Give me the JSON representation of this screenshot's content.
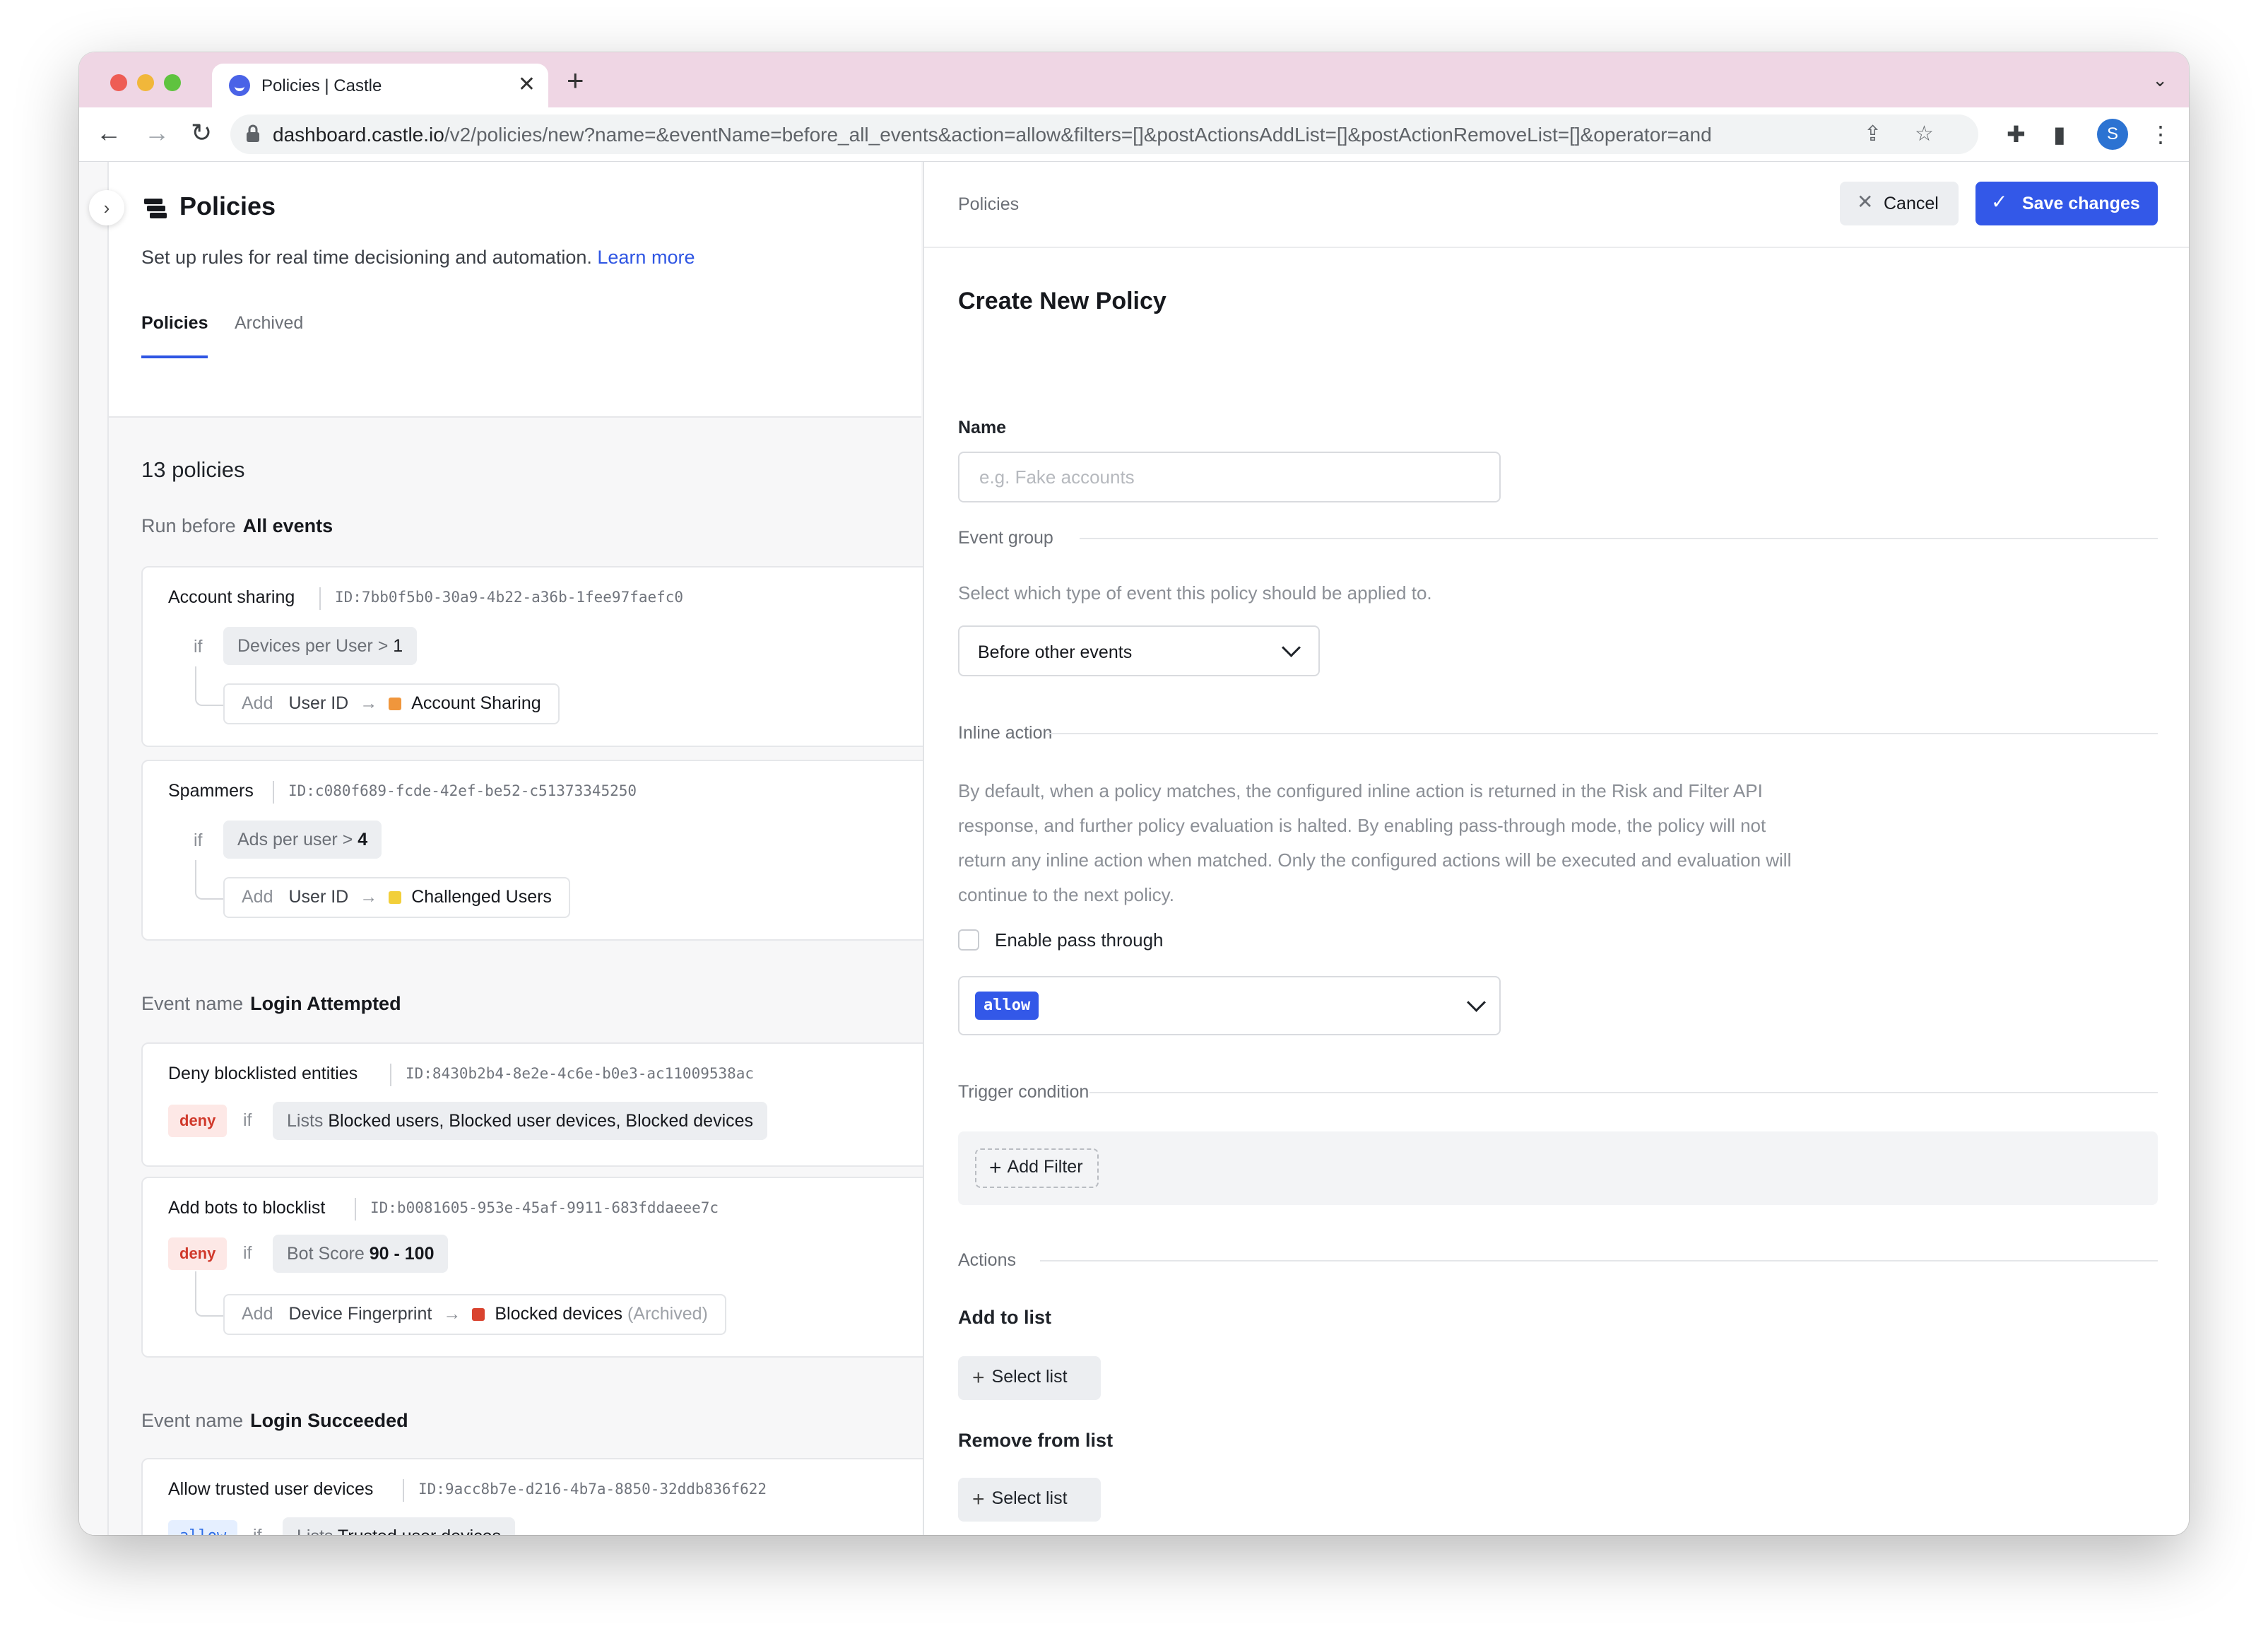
{
  "browser": {
    "tab_title": "Policies | Castle",
    "url_host": "dashboard.castle.io",
    "url_path": "/v2/policies/new?name=&eventName=before_all_events&action=allow&filters=[]&postActionsAddList=[]&postActionRemoveList=[]&operator=and",
    "profile_initial": "S"
  },
  "page": {
    "title": "Policies",
    "subtitle": "Set up rules for real time decisioning and automation.",
    "learn_more": "Learn more",
    "tabs": [
      "Policies",
      "Archived"
    ],
    "count": "13 policies"
  },
  "groups": [
    {
      "prefix": "Run before",
      "name": "All events",
      "policies": [
        {
          "name": "Account sharing",
          "id": "ID:7bb0f5b0-30a9-4b22-a36b-1fee97faefc0",
          "if": "if",
          "cond_field": "Devices per User",
          "cond_op": ">",
          "cond_value": "1",
          "add": "Add",
          "add_field": "User ID",
          "list": "Account Sharing",
          "list_color": "#f0963c"
        },
        {
          "name": "Spammers",
          "id": "ID:c080f689-fcde-42ef-be52-c51373345250",
          "if": "if",
          "cond_field": "Ads per user",
          "cond_op": ">",
          "cond_value": "4",
          "add": "Add",
          "add_field": "User ID",
          "list": "Challenged Users",
          "list_color": "#f2cf3a"
        }
      ]
    },
    {
      "prefix": "Event name",
      "name": "Login Attempted",
      "policies": [
        {
          "name": "Deny blocklisted entities",
          "id": "ID:8430b2b4-8e2e-4c6e-b0e3-ac11009538ac",
          "verdict": "deny",
          "if": "if",
          "cond_field": "Lists",
          "cond_value": "Blocked users, Blocked user devices, Blocked devices"
        },
        {
          "name": "Add bots to blocklist",
          "id": "ID:b0081605-953e-45af-9911-683fddaeee7c",
          "verdict": "deny",
          "if": "if",
          "cond_field": "Bot Score",
          "cond_value": "90 - 100",
          "add": "Add",
          "add_field": "Device Fingerprint",
          "list": "Blocked devices",
          "list_suffix": "(Archived)",
          "list_color": "#d9432f"
        }
      ]
    },
    {
      "prefix": "Event name",
      "name": "Login Succeeded",
      "policies": [
        {
          "name": "Allow trusted user devices",
          "id": "ID:9acc8b7e-d216-4b7a-8850-32ddb836f622",
          "verdict": "allow",
          "if": "if",
          "cond_field": "Lists",
          "cond_value": "Trusted user devices"
        }
      ]
    }
  ],
  "panel": {
    "breadcrumb": "Policies",
    "cancel_label": "Cancel",
    "save_label": "Save changes",
    "title": "Create New Policy",
    "name_label": "Name",
    "name_value": "",
    "name_placeholder": "e.g. Fake accounts",
    "event_group_heading": "Event group",
    "event_group_help": "Select which type of event this policy should be applied to.",
    "event_group_value": "Before other events",
    "inline_action_heading": "Inline action",
    "inline_action_help_lines": [
      "By default, when a policy matches, the configured inline action is returned in the Risk and Filter API",
      "response, and further policy evaluation is halted. By enabling pass-through mode, the policy will not",
      "return any inline action when matched. Only the configured actions will be executed and evaluation will",
      "continue to the next policy."
    ],
    "pass_through_label": "Enable pass through",
    "pass_through_checked": false,
    "inline_action_value": "allow",
    "trigger_heading": "Trigger condition",
    "add_filter_label": "Add Filter",
    "actions_heading": "Actions",
    "add_to_list_label": "Add to list",
    "remove_from_list_label": "Remove from list",
    "select_list_label": "Select list"
  }
}
